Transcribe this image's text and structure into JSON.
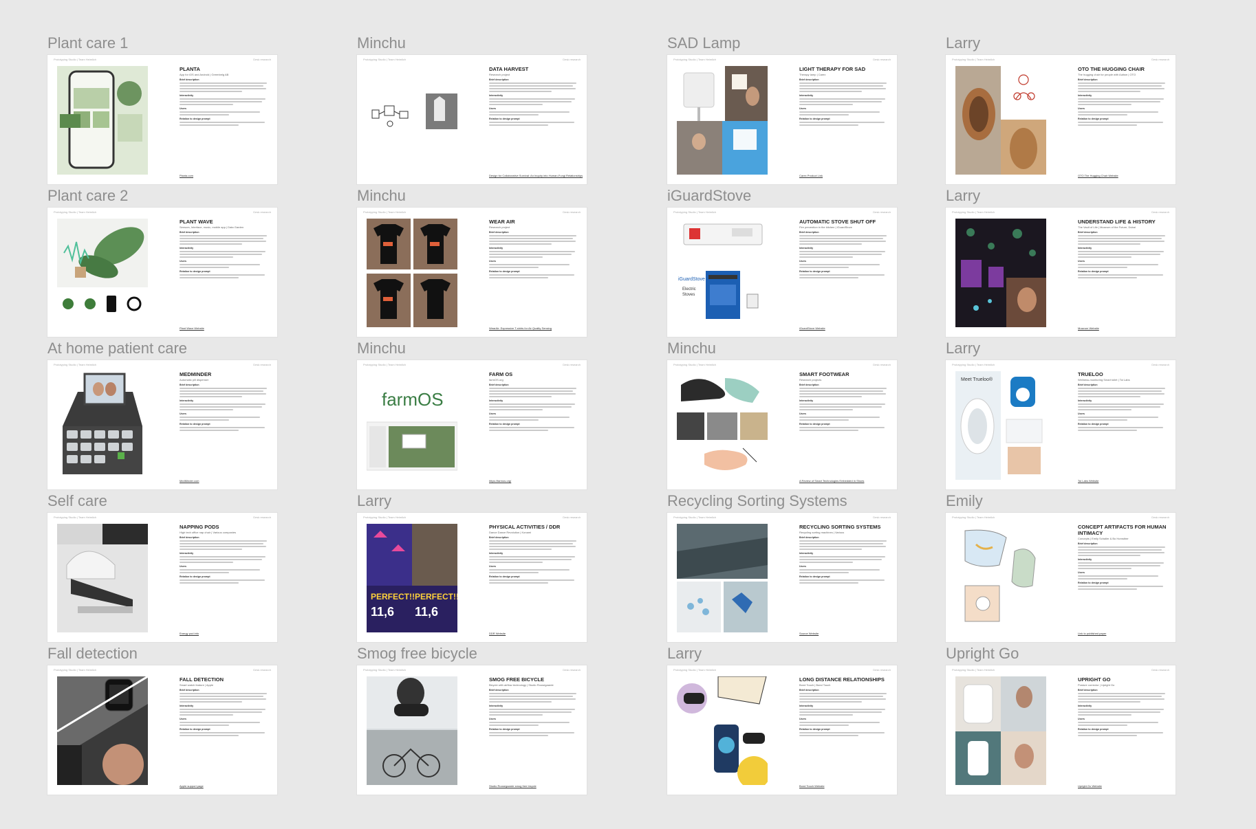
{
  "common": {
    "header_left": "Prototyping Studio | Team Heimlich",
    "header_right": "Desk research"
  },
  "cards": [
    {
      "label": "Plant care 1",
      "title": "PLANTA",
      "subtitle": "App for iOS and Android | Greenbelg AB",
      "link": "Planta.com",
      "theme": "plants"
    },
    {
      "label": "Minchu",
      "title": "DATA HARVEST",
      "subtitle": "Research project",
      "link": "Design for Collaborative Survival: An Inquiry into Human-Fungi Relationships",
      "theme": "diagram"
    },
    {
      "label": "SAD Lamp",
      "title": "LIGHT THERAPY FOR SAD",
      "subtitle": "Therapy lamp | Carex",
      "link": "Carex Product Link",
      "theme": "lamp"
    },
    {
      "label": "Larry",
      "title": "OTO THE HUGGING CHAIR",
      "subtitle": "The hugging chair for people with Autism | OTO",
      "link": "OTO The Hugging Chair Website",
      "theme": "chair"
    },
    {
      "label": "Plant care 2",
      "title": "PLANT WAVE",
      "subtitle": "Sensors, Interface, music, mobile app | Data Garden",
      "link": "Plant Wave Website",
      "theme": "leaf"
    },
    {
      "label": "Minchu",
      "title": "WEAR AIR",
      "subtitle": "Research project",
      "link": "WearAir: Expressive T-shirts for Air Quality Sensing",
      "theme": "shirts"
    },
    {
      "label": "iGuardStove",
      "title": "AUTOMATIC STOVE SHUT OFF",
      "subtitle": "Fire prevention in the kitchen | iGuardStove",
      "link": "iGuardStove Website",
      "theme": "stove"
    },
    {
      "label": "Larry",
      "title": "UNDERSTAND LIFE & HISTORY",
      "subtitle": "The Vault of Life | Museum of the Future, Dubai",
      "link": "Museum Website",
      "theme": "museum"
    },
    {
      "label": "At home patient care",
      "title": "MEDMINDER",
      "subtitle": "Automatic pill dispenser",
      "link": "MedMinder.com",
      "theme": "pills"
    },
    {
      "label": "Minchu",
      "title": "FARM OS",
      "subtitle": "farmOS.org",
      "link": "https://farmos.org/",
      "theme": "farmos"
    },
    {
      "label": "Minchu",
      "title": "SMART FOOTWEAR",
      "subtitle": "Research projects",
      "link": "A Review of Smart Technologies Embedded in Shoes",
      "theme": "shoes"
    },
    {
      "label": "Larry",
      "title": "TRUELOO",
      "subtitle": "Wellness-monitoring Smart toilet | Toi Labs",
      "link": "Toi Labs Website",
      "theme": "toilet"
    },
    {
      "label": "Self care",
      "title": "NAPPING PODS",
      "subtitle": "High tech office nap chair | Various companies",
      "link": "Energy pod info",
      "theme": "pod"
    },
    {
      "label": "Larry",
      "title": "PHYSICAL ACTIVITIES / DDR",
      "subtitle": "Dance Dance Revolution | Konami",
      "link": "DDR Website",
      "theme": "ddr"
    },
    {
      "label": "Recycling Sorting Systems",
      "title": "RECYCLING SORTING SYSTEMS",
      "subtitle": "Recycling sorting machines | Various",
      "link": "Source Website",
      "theme": "recycle"
    },
    {
      "label": "Emily",
      "title": "CONCEPT ARTIFACTS FOR HUMAN INTIMACY",
      "subtitle": "Concepts | Emily Schaller & Bo Homsther",
      "link": "Link to published paper",
      "theme": "sketch"
    },
    {
      "label": "Fall detection",
      "title": "FALL DETECTION",
      "subtitle": "Smart watch feature | Apple",
      "link": "Apple support page",
      "theme": "fall"
    },
    {
      "label": "Smog free bicycle",
      "title": "SMOG FREE BICYCLE",
      "subtitle": "Bicycle with airflow technology | Studio Roosegaarde",
      "link": "Studio Roosegaarde smog free bicycle",
      "theme": "bike"
    },
    {
      "label": "Larry",
      "title": "LONG DISTANCE RELATIONSHIPS",
      "subtitle": "Bond Touch | Bond Touch",
      "link": "Bond Touch Website",
      "theme": "bond"
    },
    {
      "label": "Upright Go",
      "title": "UPRIGHT GO",
      "subtitle": "Posture corrector | Upright Go",
      "link": "Upright Go Website",
      "theme": "posture"
    }
  ]
}
